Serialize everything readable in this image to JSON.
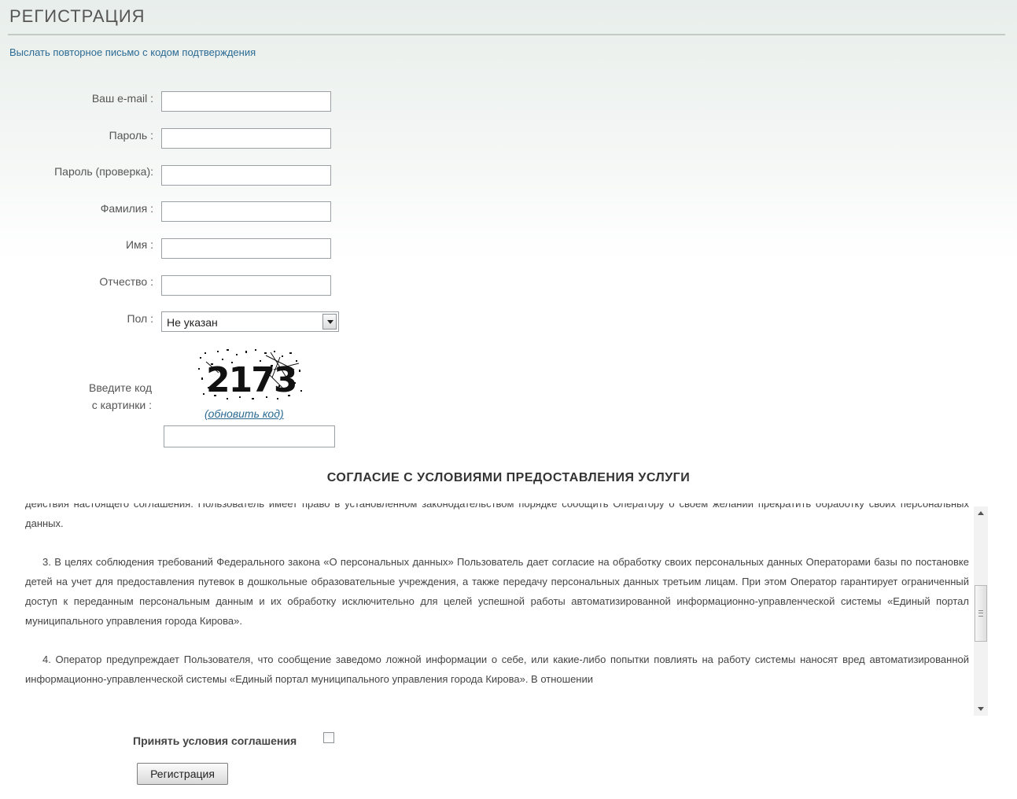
{
  "page": {
    "title": "РЕГИСТРАЦИЯ",
    "resend_link": "Выслать повторное письмо с кодом подтверждения"
  },
  "form": {
    "email_label": "Ваш e-mail :",
    "email_value": "",
    "password_label": "Пароль :",
    "password_value": "",
    "password_confirm_label": "Пароль (проверка):",
    "password_confirm_value": "",
    "lastname_label": "Фамилия :",
    "lastname_value": "",
    "firstname_label": "Имя :",
    "firstname_value": "",
    "middlename_label": "Отчество :",
    "middlename_value": "",
    "gender_label": "Пол :",
    "gender_selected": "Не указан",
    "captcha_label_line1": "Введите код",
    "captcha_label_line2": "с картинки :",
    "captcha_code": "2173",
    "captcha_refresh": "(обновить код)",
    "captcha_value": ""
  },
  "agreement": {
    "heading": "СОГЛАСИЕ С УСЛОВИЯМИ ПРЕДОСТАВЛЕНИЯ УСЛУГИ",
    "paragraphs": [
      "действия настоящего соглашения. Пользователь имеет право в установленном законодательством порядке сообщить Оператору о своем желании прекратить обработку своих персональных данных.",
      "3. В целях соблюдения требований Федерального закона «О персональных данных» Пользователь дает согласие на обработку своих персональных данных Операторами базы по постановке детей на учет для предоставления путевок в дошкольные образовательные учреждения, а также передачу персональных данных третьим лицам. При этом Оператор гарантирует ограниченный доступ к переданным персональным данным и их обработку исключительно для целей успешной работы автоматизированной информационно-управленческой системы «Единый портал муниципального управления города Кирова».",
      "4. Оператор предупреждает Пользователя, что сообщение заведомо ложной информации о себе, или какие-либо попытки повлиять на работу системы наносят вред автоматизированной информационно-управленческой системы «Единый портал муниципального управления города Кирова». В отношении"
    ],
    "accept_label": "Принять условия соглашения",
    "accept_checked": false,
    "register_button": "Регистрация"
  },
  "colors": {
    "link": "#2b6a93",
    "text": "#444444",
    "header_gradient_top": "#e8eeeb"
  }
}
